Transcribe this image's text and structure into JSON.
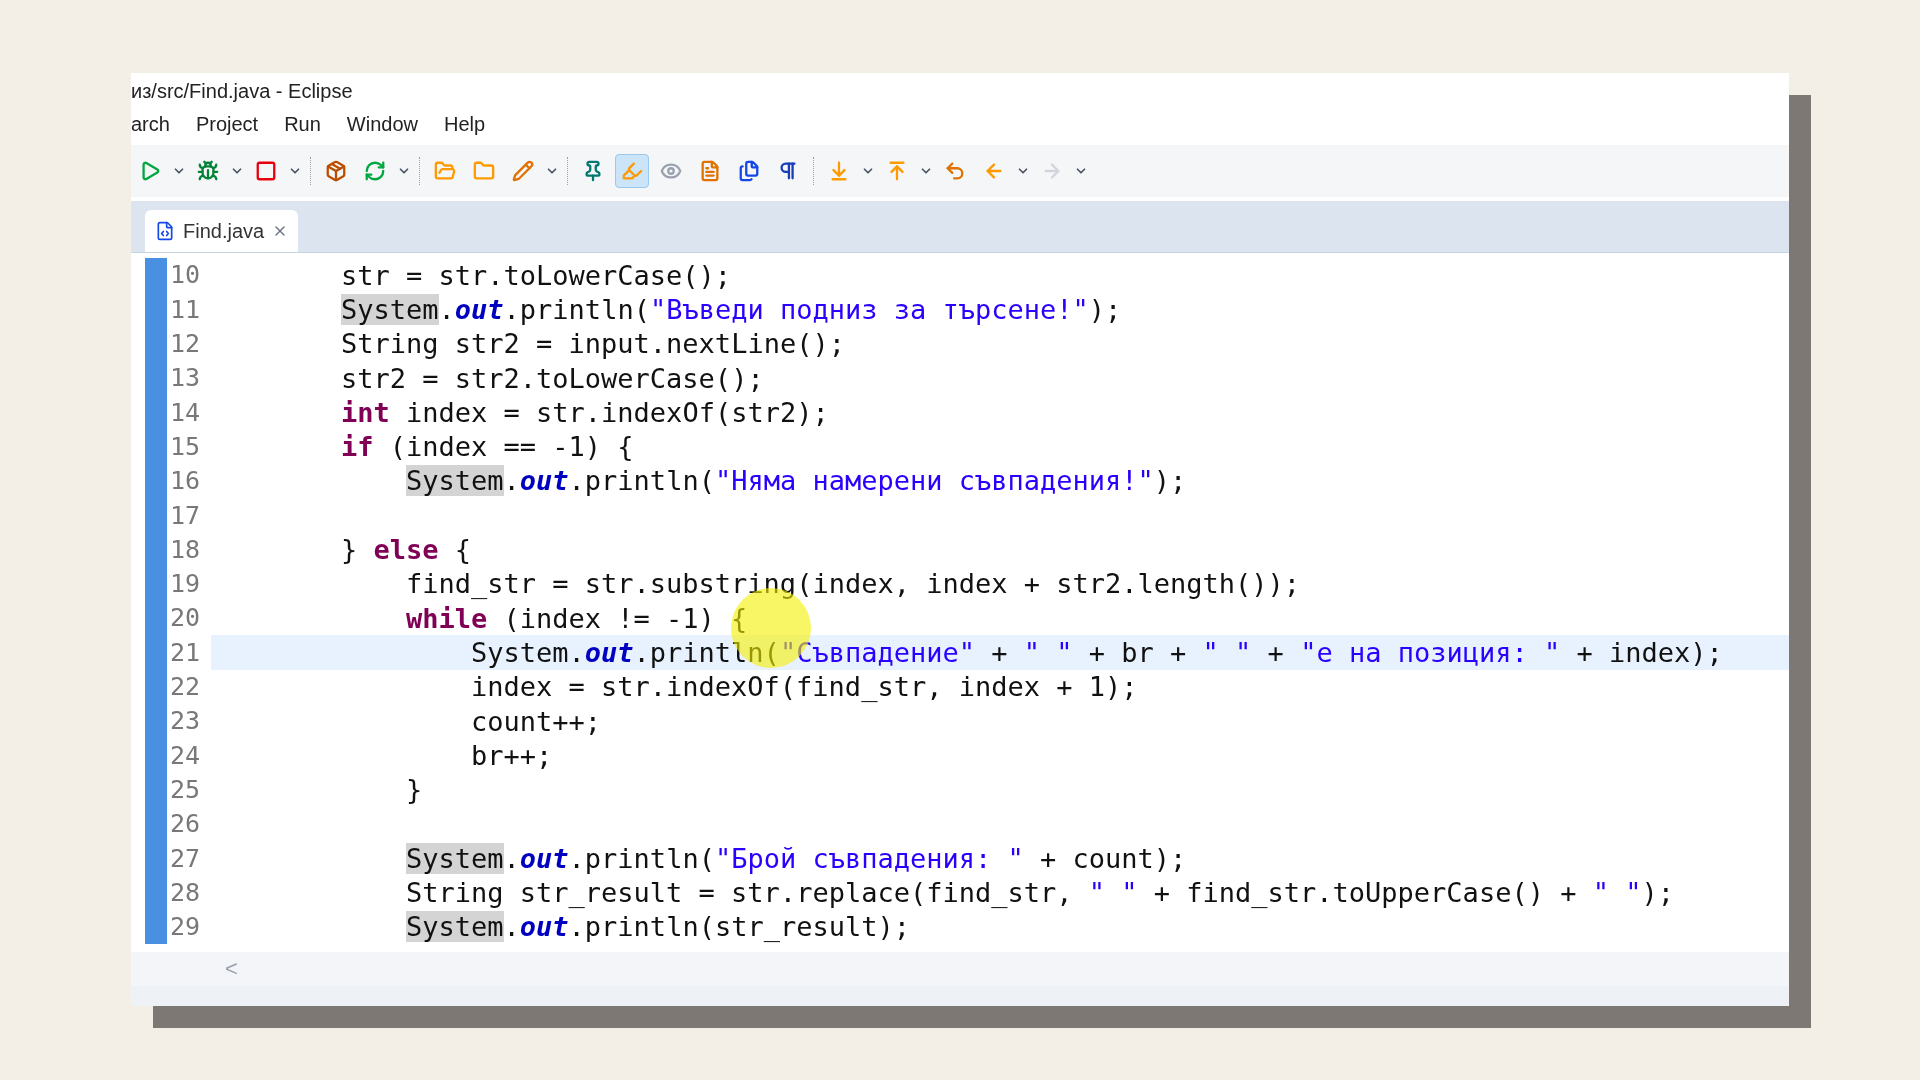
{
  "window": {
    "title": "из/src/Find.java - Eclipse"
  },
  "menu": [
    "arch",
    "Project",
    "Run",
    "Window",
    "Help"
  ],
  "toolbar_buttons": [
    {
      "pressed": false,
      "dropdown": true
    },
    {
      "pressed": false,
      "dropdown": true
    },
    {
      "pressed": false,
      "dropdown": true
    },
    {
      "pressed": false,
      "dropdown": false
    },
    {
      "pressed": false,
      "dropdown": true
    },
    {
      "pressed": false,
      "dropdown": false
    },
    {
      "pressed": false,
      "dropdown": false
    },
    {
      "pressed": false,
      "dropdown": true
    },
    {
      "pressed": false,
      "dropdown": false
    },
    {
      "pressed": true,
      "dropdown": false
    },
    {
      "pressed": false,
      "dropdown": false
    },
    {
      "pressed": false,
      "dropdown": false
    },
    {
      "pressed": false,
      "dropdown": false
    },
    {
      "pressed": false,
      "dropdown": false
    },
    {
      "pressed": false,
      "dropdown": true
    },
    {
      "pressed": false,
      "dropdown": true
    },
    {
      "pressed": false,
      "dropdown": false
    },
    {
      "pressed": false,
      "dropdown": true
    },
    {
      "pressed": false,
      "dropdown": true
    }
  ],
  "tabs": [
    {
      "label": "Find.java",
      "selected": true
    }
  ],
  "code_lines": [
    {
      "number": "10",
      "current": false,
      "tokens": [
        {
          "kind": "plain",
          "text": "str = str.toLowerCase();"
        }
      ]
    },
    {
      "number": "11",
      "current": false,
      "tokens": [
        {
          "kind": "class_ref",
          "text": "System"
        },
        {
          "kind": "plain",
          "text": "."
        },
        {
          "kind": "field",
          "text": "out"
        },
        {
          "kind": "plain",
          "text": ".println("
        },
        {
          "kind": "string",
          "text": "\"Въведи подниз за търсене!\""
        },
        {
          "kind": "plain",
          "text": ");"
        }
      ]
    },
    {
      "number": "12",
      "current": false,
      "tokens": [
        {
          "kind": "plain",
          "text": "String str2 = input.nextLine();"
        }
      ]
    },
    {
      "number": "13",
      "current": false,
      "tokens": [
        {
          "kind": "plain",
          "text": "str2 = str2.toLowerCase();"
        }
      ]
    },
    {
      "number": "14",
      "current": false,
      "tokens": [
        {
          "kind": "keyword",
          "text": "int"
        },
        {
          "kind": "plain",
          "text": " index = str.indexOf(str2);"
        }
      ]
    },
    {
      "number": "15",
      "current": false,
      "tokens": [
        {
          "kind": "keyword",
          "text": "if"
        },
        {
          "kind": "plain",
          "text": " (index == -1) {"
        }
      ],
      "children": [
        {
          "number": "16",
          "current": false,
          "tokens": [
            {
              "kind": "class_ref",
              "text": "System"
            },
            {
              "kind": "plain",
              "text": "."
            },
            {
              "kind": "field",
              "text": "out"
            },
            {
              "kind": "plain",
              "text": ".println("
            },
            {
              "kind": "string",
              "text": "\"Няма намерени съвпадения!\""
            },
            {
              "kind": "plain",
              "text": ");"
            }
          ]
        },
        {
          "number": "17",
          "current": false
        }
      ]
    },
    {
      "number": "18",
      "current": false,
      "tokens": [
        {
          "kind": "plain",
          "text": "} "
        },
        {
          "kind": "keyword",
          "text": "else"
        },
        {
          "kind": "plain",
          "text": " {"
        }
      ],
      "children": [
        {
          "number": "19",
          "current": false,
          "tokens": [
            {
              "kind": "plain",
              "text": "find_str = str.substring(index, index + str2.length());"
            }
          ]
        },
        {
          "number": "20",
          "current": false,
          "tokens": [
            {
              "kind": "keyword",
              "text": "while"
            },
            {
              "kind": "plain",
              "text": " (index != -1) {"
            }
          ],
          "children": [
            {
              "number": "21",
              "current": true,
              "tokens": [
                {
                  "kind": "plain",
                  "text": "System."
                },
                {
                  "kind": "field",
                  "text": "out"
                },
                {
                  "kind": "plain",
                  "text": ".println("
                },
                {
                  "kind": "string",
                  "text": "\"Съвпадение\""
                },
                {
                  "kind": "plain",
                  "text": " + "
                },
                {
                  "kind": "string",
                  "text": "\" \""
                },
                {
                  "kind": "plain",
                  "text": " + br + "
                },
                {
                  "kind": "string",
                  "text": "\" \""
                },
                {
                  "kind": "plain",
                  "text": " + "
                },
                {
                  "kind": "string",
                  "text": "\"е на позиция: \""
                },
                {
                  "kind": "plain",
                  "text": " + index);"
                }
              ]
            },
            {
              "number": "22",
              "current": false,
              "tokens": [
                {
                  "kind": "plain",
                  "text": "index = str.indexOf(find_str, index + 1);"
                }
              ]
            },
            {
              "number": "23",
              "current": false,
              "tokens": [
                {
                  "kind": "plain",
                  "text": "count++;"
                }
              ]
            },
            {
              "number": "24",
              "current": false,
              "tokens": [
                {
                  "kind": "plain",
                  "text": "br++;"
                }
              ]
            }
          ]
        },
        {
          "number": "25",
          "current": false,
          "tokens": [
            {
              "kind": "plain",
              "text": "}"
            }
          ]
        },
        {
          "number": "26",
          "current": false
        },
        {
          "number": "27",
          "current": false,
          "tokens": [
            {
              "kind": "class_ref",
              "text": "System"
            },
            {
              "kind": "plain",
              "text": "."
            },
            {
              "kind": "field",
              "text": "out"
            },
            {
              "kind": "plain",
              "text": ".println("
            },
            {
              "kind": "string",
              "text": "\"Брой съвпадения: \""
            },
            {
              "kind": "plain",
              "text": " + count);"
            }
          ]
        },
        {
          "number": "28",
          "current": false,
          "tokens": [
            {
              "kind": "plain",
              "text": "String str_result = str.replace(find_str, "
            },
            {
              "kind": "string",
              "text": "\" \""
            },
            {
              "kind": "plain",
              "text": " + find_str.toUpperCase() + "
            },
            {
              "kind": "string",
              "text": "\" \""
            },
            {
              "kind": "plain",
              "text": ");"
            }
          ]
        },
        {
          "number": "29",
          "current": false,
          "tokens": [
            {
              "kind": "class_ref",
              "text": "System"
            },
            {
              "kind": "plain",
              "text": "."
            },
            {
              "kind": "field",
              "text": "out"
            },
            {
              "kind": "plain",
              "text": ".println(str_result);"
            }
          ]
        }
      ]
    }
  ],
  "scroll_arrow": "<"
}
